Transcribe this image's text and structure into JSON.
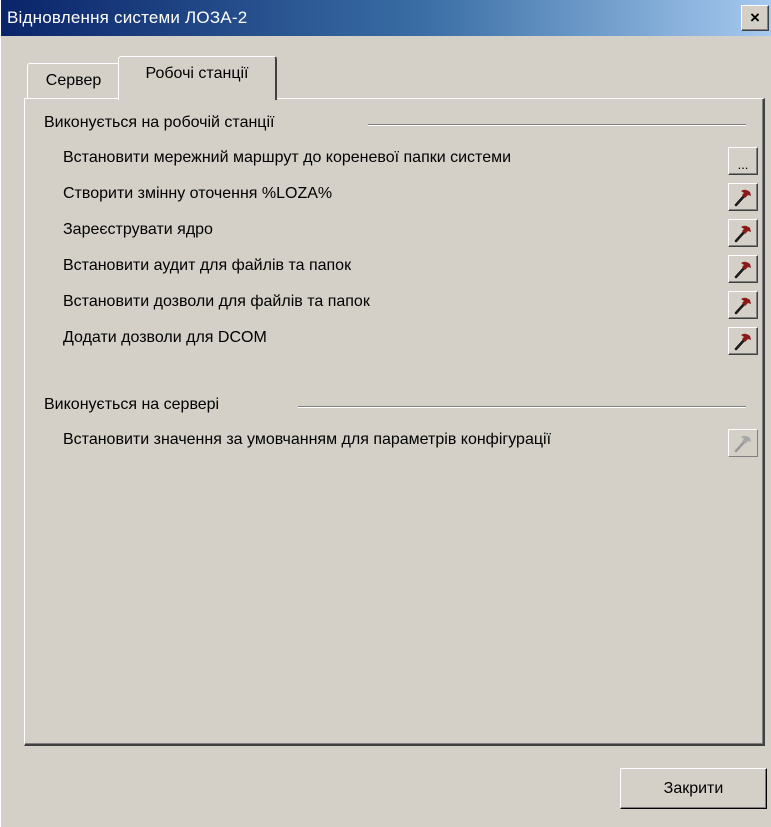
{
  "window": {
    "title": "Відновлення системи ЛОЗА-2",
    "close_glyph": "×"
  },
  "tabs": [
    {
      "label": "Сервер",
      "selected": false
    },
    {
      "label": "Робочі станції",
      "selected": true
    }
  ],
  "groups": [
    {
      "title": "Виконується на робочій станції",
      "items": [
        {
          "label": "Встановити мережний маршрут до кореневої папки системи",
          "action": "browse",
          "button_text": "...",
          "enabled": true
        },
        {
          "label": "Створити змінну оточення %LOZA%",
          "action": "hammer-icon",
          "enabled": true
        },
        {
          "label": "Зареєструвати ядро",
          "action": "hammer-icon",
          "enabled": true
        },
        {
          "label": "Встановити аудит для файлів та папок",
          "action": "hammer-icon",
          "enabled": true
        },
        {
          "label": "Встановити дозволи для файлів та папок",
          "action": "hammer-icon",
          "enabled": true
        },
        {
          "label": "Додати дозволи для DCOM",
          "action": "hammer-icon",
          "enabled": true
        }
      ]
    },
    {
      "title": "Виконується на сервері",
      "items": [
        {
          "label": "Встановити значення за умовчанням для параметрів конфігурації",
          "action": "hammer-icon",
          "enabled": false
        }
      ]
    }
  ],
  "footer": {
    "close_label": "Закрити"
  },
  "colors": {
    "titlebar_start": "#0a246a",
    "titlebar_end": "#a6caf0",
    "face": "#d4d0c8",
    "hammer_head": "#8b1a1a",
    "hammer_handle": "#1c1c1c"
  }
}
